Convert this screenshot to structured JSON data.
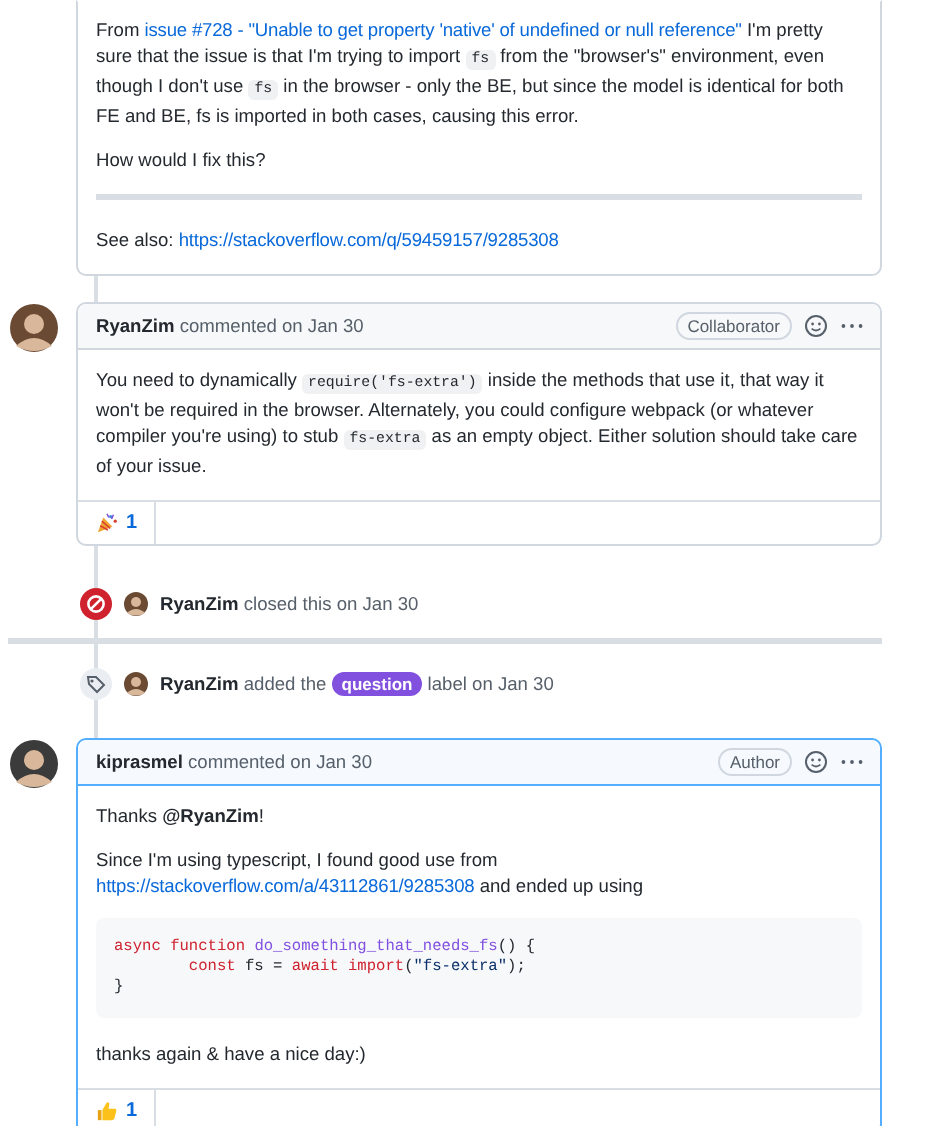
{
  "timeline": [
    {
      "kind": "comment",
      "highlighted": false,
      "body": [
        {
          "kind": "para",
          "parts": [
            {
              "kind": "text",
              "text": "From "
            },
            {
              "kind": "link",
              "text": "issue #728 - \"Unable to get property 'native' of undefined or null reference\""
            },
            {
              "kind": "text",
              "text": " I'm pretty sure that the issue is that I'm trying to import "
            },
            {
              "kind": "code",
              "text": "fs"
            },
            {
              "kind": "text",
              "text": " from the \"browser's\" environment, even though I don't use "
            },
            {
              "kind": "code",
              "text": "fs"
            },
            {
              "kind": "text",
              "text": " in the browser - only the BE, but since the model is identical for both FE and BE, fs is imported in both cases, causing this error."
            }
          ]
        },
        {
          "kind": "para",
          "parts": [
            {
              "kind": "text",
              "text": "How would I fix this?"
            }
          ]
        },
        {
          "kind": "rule"
        },
        {
          "kind": "para",
          "parts": [
            {
              "kind": "text",
              "text": "See also: "
            },
            {
              "kind": "link",
              "text": "https://stackoverflow.com/q/59459157/9285308"
            }
          ]
        }
      ]
    },
    {
      "kind": "comment",
      "highlighted": false,
      "header": {
        "author": "RyanZim",
        "action": "commented on Jan 30",
        "badge": "Collaborator"
      },
      "body": [
        {
          "kind": "para",
          "parts": [
            {
              "kind": "text",
              "text": "You need to dynamically "
            },
            {
              "kind": "code",
              "text": "require('fs-extra')"
            },
            {
              "kind": "text",
              "text": " inside the methods that use it, that way it won't be required in the browser. Alternately, you could configure webpack (or whatever compiler you're using) to stub "
            },
            {
              "kind": "code",
              "text": "fs-extra"
            },
            {
              "kind": "text",
              "text": " as an empty object. Either solution should take care of your issue."
            }
          ]
        }
      ],
      "reactions": [
        {
          "kind": "party",
          "count": "1"
        }
      ]
    },
    {
      "kind": "closed",
      "parts": [
        {
          "kind": "bold",
          "text": "RyanZim"
        },
        {
          "kind": "text",
          "text": " closed this on Jan 30"
        }
      ]
    },
    {
      "kind": "break"
    },
    {
      "kind": "labeled",
      "parts": [
        {
          "kind": "bold",
          "text": "RyanZim"
        },
        {
          "kind": "text",
          "text": " added the "
        },
        {
          "kind": "label",
          "text": "question",
          "color": "#8250df"
        },
        {
          "kind": "text",
          "text": " label on Jan 30"
        }
      ]
    },
    {
      "kind": "comment",
      "highlighted": true,
      "header": {
        "author": "kiprasmel",
        "action": "commented on Jan 30",
        "badge": "Author"
      },
      "body": [
        {
          "kind": "para",
          "parts": [
            {
              "kind": "text",
              "text": "Thanks **@RyanZim**!"
            }
          ]
        },
        {
          "kind": "para",
          "parts": [
            {
              "kind": "text",
              "text": "Since I'm using typescript, I found good use from "
            },
            {
              "kind": "link",
              "text": "https://stackoverflow.com/a/43112861/9285308"
            },
            {
              "kind": "text",
              "text": " and ended up using"
            }
          ]
        },
        {
          "kind": "code_block",
          "lines": [
            [
              {
                "kind": "keyword",
                "text": "async function "
              },
              {
                "kind": "function",
                "text": "do_something_that_needs_fs"
              },
              {
                "kind": "plain",
                "text": "() {"
              }
            ],
            [
              {
                "kind": "keyword",
                "text": "        const"
              },
              {
                "kind": "plain",
                "text": " fs = "
              },
              {
                "kind": "keyword",
                "text": "await import"
              },
              {
                "kind": "plain",
                "text": "("
              },
              {
                "kind": "string",
                "text": "\"fs-extra\""
              },
              {
                "kind": "plain",
                "text": ");"
              }
            ],
            [
              {
                "kind": "plain",
                "text": "}"
              }
            ]
          ]
        },
        {
          "kind": "para",
          "parts": [
            {
              "kind": "text",
              "text": "thanks again & have a nice day:)"
            }
          ]
        }
      ],
      "reactions": [
        {
          "kind": "thumbs-up",
          "count": "1"
        }
      ]
    }
  ]
}
